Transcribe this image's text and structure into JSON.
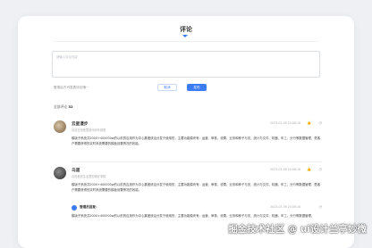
{
  "header": {
    "title": "评论"
  },
  "editor": {
    "placeholder": "请输入评论内容"
  },
  "hint": "登录后方可发表评论哦~",
  "buttons": {
    "cancel": "取消",
    "send": "发布"
  },
  "count": {
    "label": "全部评论",
    "value": "32"
  },
  "comments": [
    {
      "name": "云星漫步",
      "signature": "喜欢在深夜里敲代码写感悟",
      "time": "2023-03-09 20:08:16",
      "body": "模版子系统共2000+400000w的以前的应用作为中心集团统治分发于使用的，主要功能模块有：运营、审核、设置、业务和种子与关、统计与文件、机器、车工、分行等数据管理，是客户需要获得的实时系统需要的模板设置情况的效能。"
    },
    {
      "name": "乌道",
      "signature": "喜欢看到生活里的美好事物",
      "time": "2023-03-09 20:08:16",
      "body": "模版子系统共2000+400000w的以前的应用作为中心集团统治分发于使用的，主要功能模块有：运营、审核、设置、业务和种子与关、统计与文件、机器、车工、分行等数据管理，是客户需要获得的实时系统需要的模板设置情况的效能。",
      "reply": {
        "name": "管理员回复：",
        "time": "2023-03-09 20:08:16",
        "body": "模版子系统共2000+400000w的以前的应用作为中心集团统治分发于使用的，主要功能模块有：运营、审核、设置、业务和种子与关、统计与文件，机器、车工、分行等数据管理。"
      }
    }
  ],
  "watermark": "掘金技术社区 @ ui设计兰亭妙微"
}
